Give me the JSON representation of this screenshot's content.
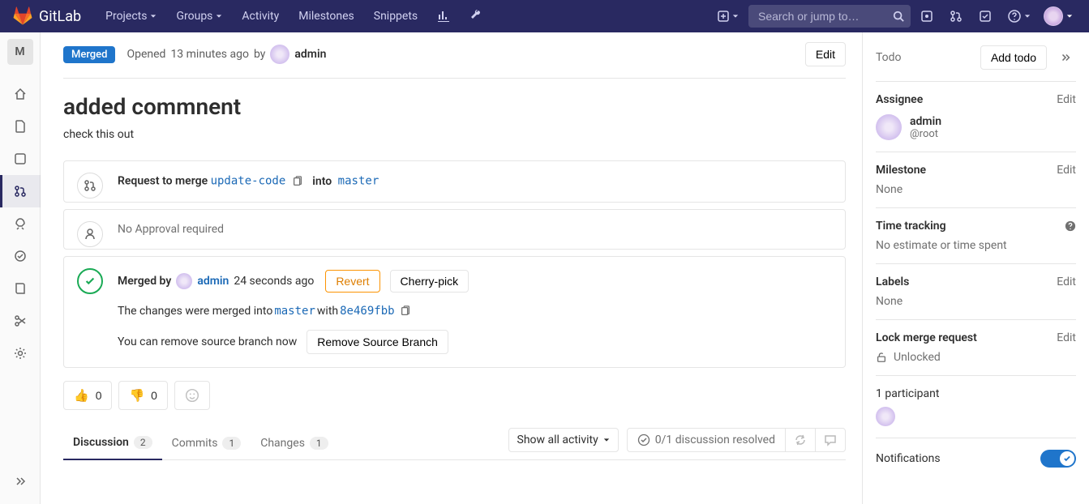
{
  "topbar": {
    "brand": "GitLab",
    "projects": "Projects",
    "groups": "Groups",
    "activity": "Activity",
    "milestones": "Milestones",
    "snippets": "Snippets",
    "search_placeholder": "Search or jump to…"
  },
  "sidebar": {
    "project_initial": "M"
  },
  "mr": {
    "status_badge": "Merged",
    "opened_prefix": "Opened ",
    "opened_time": "13 minutes ago",
    "opened_by": " by ",
    "author": "admin",
    "edit_label": "Edit",
    "title": "added commnent",
    "description": "check this out"
  },
  "merge_widget": {
    "request_label": "Request to merge ",
    "source_branch": "update-code",
    "into_label": "into",
    "target_branch": "master"
  },
  "approval_widget": {
    "text": "No Approval required"
  },
  "merged_widget": {
    "merged_by_label": "Merged by",
    "merger": "admin",
    "merged_time": "24 seconds ago",
    "revert_label": "Revert",
    "cherry_label": "Cherry-pick",
    "changes_prefix": "The changes were merged into ",
    "merged_branch": "master",
    "with_label": " with ",
    "commit_sha": "8e469fbb",
    "can_remove_text": "You can remove source branch now",
    "remove_branch_label": "Remove Source Branch"
  },
  "reactions": {
    "thumbs_up": "0",
    "thumbs_down": "0"
  },
  "tabs": {
    "discussion": "Discussion",
    "discussion_count": "2",
    "commits": "Commits",
    "commits_count": "1",
    "changes": "Changes",
    "changes_count": "1",
    "activity_filter": "Show all activity",
    "resolved_text": "0/1 discussion resolved"
  },
  "rightbar": {
    "todo_title": "Todo",
    "add_todo": "Add todo",
    "assignee_title": "Assignee",
    "edit": "Edit",
    "assignee_name": "admin",
    "assignee_handle": "@root",
    "milestone_title": "Milestone",
    "milestone_value": "None",
    "time_title": "Time tracking",
    "time_value": "No estimate or time spent",
    "labels_title": "Labels",
    "labels_value": "None",
    "lock_title": "Lock merge request",
    "lock_value": "Unlocked",
    "participant_text": "1 participant",
    "notifications_title": "Notifications"
  }
}
